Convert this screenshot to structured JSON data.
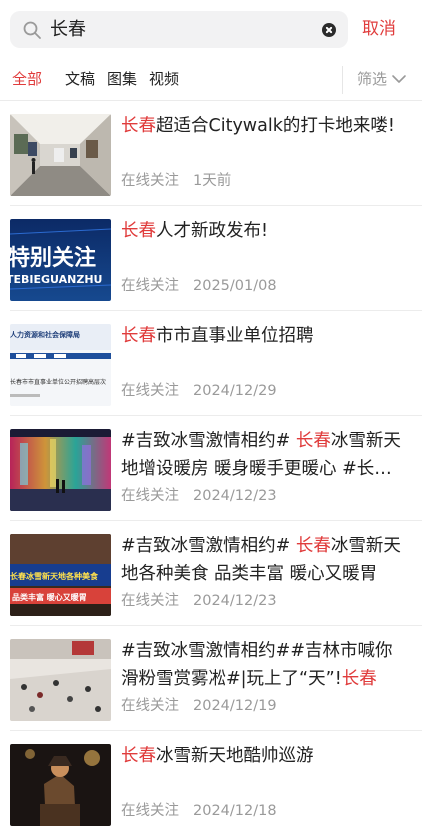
{
  "search": {
    "query": "长春",
    "cancel_label": "取消"
  },
  "tabs": [
    {
      "label": "全部",
      "active": true
    },
    {
      "label": "文稿",
      "active": false
    },
    {
      "label": "图集",
      "active": false
    },
    {
      "label": "视频",
      "active": false
    }
  ],
  "filter": {
    "label": "筛选",
    "icon": "chevron-down-icon"
  },
  "colors": {
    "accent": "#e03c3c",
    "meta": "#9a9a9a"
  },
  "items": [
    {
      "title_hl": "长春",
      "title_pre": "",
      "title_rest": "超适合Citywalk的打卡地来喽!",
      "source": "在线关注",
      "time": "1天前",
      "thumb": "gallery-hall"
    },
    {
      "title_hl": "长春",
      "title_pre": "",
      "title_rest": "人才新政发布!",
      "source": "在线关注",
      "time": "2025/01/08",
      "thumb": "tebieguanzhu-banner"
    },
    {
      "title_hl": "长春",
      "title_pre": "",
      "title_rest": "市市直事业单位招聘",
      "source": "在线关注",
      "time": "2024/12/29",
      "thumb": "recruitment-notice"
    },
    {
      "title_hl": "长春",
      "title_pre": "#吉致冰雪激情相约# ",
      "title_rest": "冰雪新天地增设暖房 暖身暖手更暖心 #长春冰雪新天地#",
      "source": "在线关注",
      "time": "2024/12/23",
      "thumb": "ice-lights"
    },
    {
      "title_hl": "长春",
      "title_pre": "#吉致冰雪激情相约# ",
      "title_rest": "冰雪新天地各种美食 品类丰富 暖心又暖胃",
      "source": "在线关注",
      "time": "2024/12/23",
      "thumb": "food-banner"
    },
    {
      "title_hl": "长春",
      "title_pre": "#吉致冰雪激情相约##吉林市喊你滑粉雪赏雾凇#|玩上了“天”!",
      "title_rest": "",
      "source": "在线关注",
      "time": "2024/12/19",
      "thumb": "ski-crowd"
    },
    {
      "title_hl": "长春",
      "title_pre": "",
      "title_rest": "冰雪新天地酷帅巡游",
      "source": "在线关注",
      "time": "2024/12/18",
      "thumb": "parade-horse"
    }
  ],
  "thumb_text": {
    "banner_big": "特别关注",
    "banner_small": "TEBIEGUANZHU",
    "notice_head": "人力资源和社会保障局",
    "notice_line": "长春市市直事业单位公开招聘高层次",
    "food_top": "长春冰雪新天地各种美食",
    "food_bottom": "品类丰富  暖心又暖胃"
  }
}
